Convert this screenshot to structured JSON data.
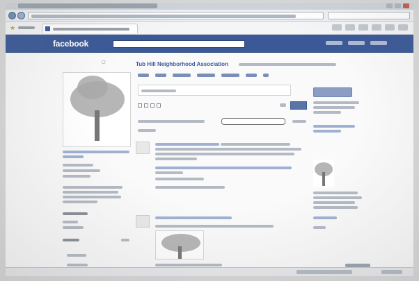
{
  "browser": {
    "title": "",
    "url": "",
    "tab_label": ""
  },
  "facebook": {
    "logo": "facebook",
    "brand_color": "#3b5998"
  },
  "page": {
    "title": "Tub Hill Neighborhood Association"
  },
  "icons": {
    "favorites": "star-icon",
    "back": "back-arrow-icon",
    "forward": "forward-arrow-icon"
  },
  "colors": {
    "facebook_blue": "#3b5998",
    "link_blue": "#3b5998",
    "page_bg": "#fafafa"
  }
}
